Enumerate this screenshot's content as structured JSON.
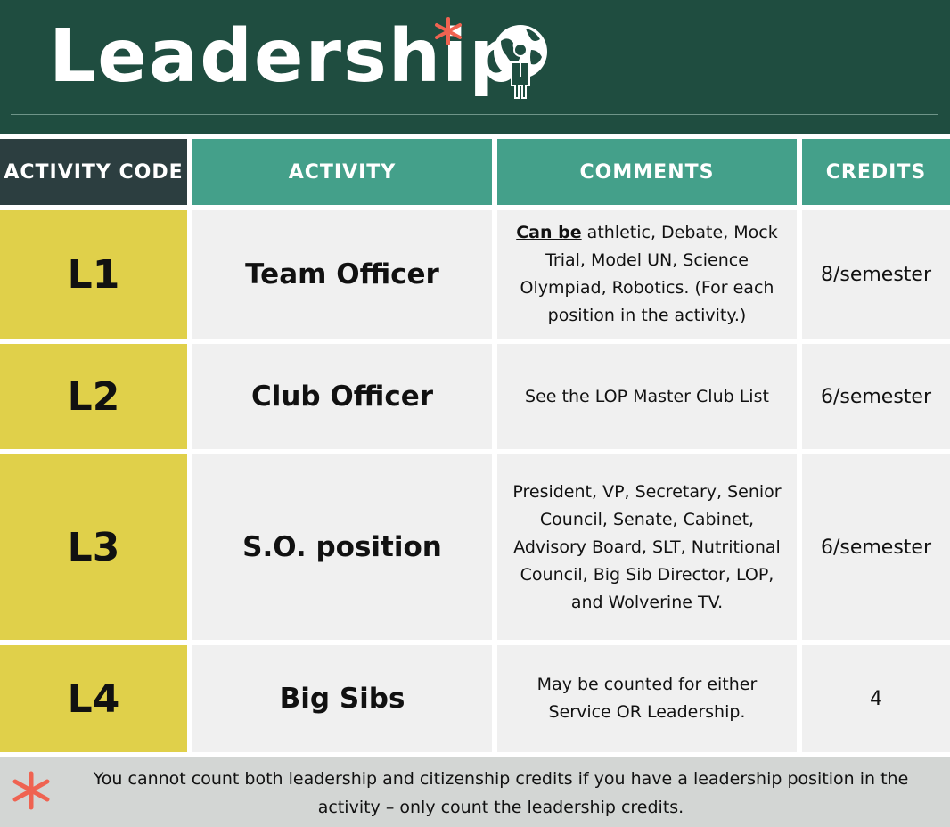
{
  "header": {
    "title": "Leadership",
    "asterisk_color": "#ef6351",
    "globe_icon": "globe-person-icon"
  },
  "table": {
    "columns": [
      "ACTIVITY CODE",
      "ACTIVITY",
      "COMMENTS",
      "CREDITS"
    ],
    "rows": [
      {
        "code": "L1",
        "activity": "Team Officer",
        "comment_emphasis": "Can be",
        "comment": " athletic, Debate, Mock Trial, Model UN, Science Olympiad, Robotics. (For each position in the activity.)",
        "credits": "8/semester"
      },
      {
        "code": "L2",
        "activity": "Club Officer",
        "comment": "See the LOP Master Club List",
        "credits": "6/semester"
      },
      {
        "code": "L3",
        "activity": "S.O. position",
        "comment": "President, VP, Secretary, Senior Council, Senate, Cabinet, Advisory Board, SLT, Nutritional Council, Big Sib Director, LOP, and Wolverine TV.",
        "credits": "6/semester"
      },
      {
        "code": "L4",
        "activity": "Big Sibs",
        "comment": "May be counted for either Service OR Leadership.",
        "credits": "4"
      }
    ]
  },
  "footer": {
    "note": "You cannot count both leadership and citizenship credits if you have a leadership position in the activity – only count the leadership credits."
  },
  "colors": {
    "header_bg": "#1f4d40",
    "col_header_dark": "#2c3e40",
    "col_header_teal": "#44a08a",
    "code_cell": "#e0d04a",
    "cell_bg": "#f0f0f0",
    "footer_bg": "#d3d6d4"
  }
}
